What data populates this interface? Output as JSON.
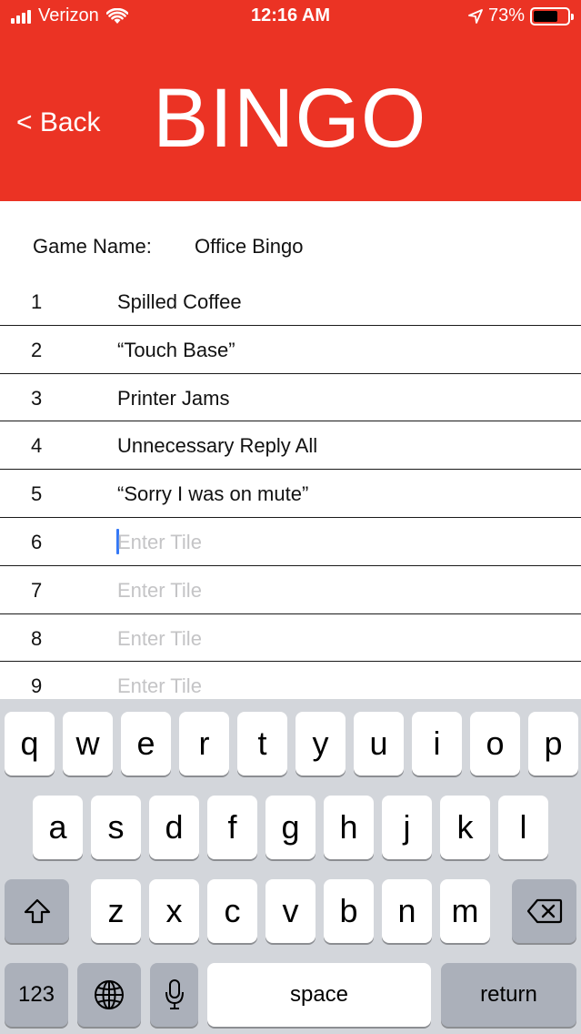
{
  "status_bar": {
    "carrier": "Verizon",
    "time": "12:16 AM",
    "battery_percent": "73%",
    "battery_level": 0.73,
    "icons": [
      "signal-icon",
      "wifi-icon",
      "location-icon",
      "battery-icon"
    ]
  },
  "header": {
    "back_label": "< Back",
    "title": "BINGO",
    "background_color": "#eb3324"
  },
  "form": {
    "game_name_label": "Game Name:",
    "game_name_value": "Office Bingo",
    "tiles": [
      {
        "number": "1",
        "text": "Spilled Coffee"
      },
      {
        "number": "2",
        "text": "“Touch Base”"
      },
      {
        "number": "3",
        "text": "Printer Jams"
      },
      {
        "number": "4",
        "text": "Unnecessary Reply All"
      },
      {
        "number": "5",
        "text": "“Sorry I was on mute”"
      },
      {
        "number": "6",
        "placeholder": "Enter Tile",
        "focused": true
      },
      {
        "number": "7",
        "placeholder": "Enter Tile"
      },
      {
        "number": "8",
        "placeholder": "Enter Tile"
      },
      {
        "number": "9",
        "placeholder": "Enter Tile"
      }
    ]
  },
  "keyboard": {
    "row1": [
      "q",
      "w",
      "e",
      "r",
      "t",
      "y",
      "u",
      "i",
      "o",
      "p"
    ],
    "row2": [
      "a",
      "s",
      "d",
      "f",
      "g",
      "h",
      "j",
      "k",
      "l"
    ],
    "row3": [
      "z",
      "x",
      "c",
      "v",
      "b",
      "n",
      "m"
    ],
    "numbers_label": "123",
    "space_label": "space",
    "return_label": "return",
    "icons": [
      "shift-icon",
      "delete-icon",
      "globe-icon",
      "microphone-icon"
    ]
  }
}
